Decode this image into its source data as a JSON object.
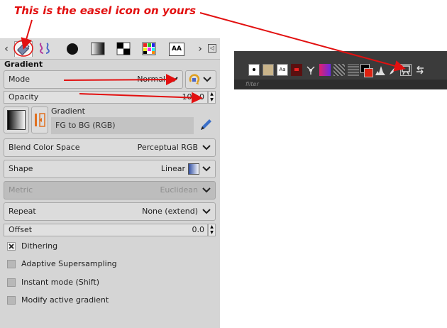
{
  "annotation": {
    "text": "This is the easel icon on yours",
    "color": "#e21010"
  },
  "tabs": [
    {
      "name": "gradient-tool-options-tab",
      "selected": true
    },
    {
      "name": "paths-tab"
    },
    {
      "name": "brushes-tab"
    },
    {
      "name": "gradients-tab"
    },
    {
      "name": "patterns-tab"
    },
    {
      "name": "palettes-tab"
    },
    {
      "name": "fonts-tab",
      "label": "AA"
    }
  ],
  "panel": {
    "title": "Gradient",
    "mode": {
      "label": "Mode",
      "value": "Normal"
    },
    "opacity": {
      "label": "Opacity",
      "value": "100.0"
    },
    "gradient": {
      "label": "Gradient",
      "value": "FG to BG (RGB)"
    },
    "blend_color_space": {
      "label": "Blend Color Space",
      "value": "Perceptual RGB"
    },
    "shape": {
      "label": "Shape",
      "value": "Linear"
    },
    "metric": {
      "label": "Metric",
      "value": "Euclidean"
    },
    "repeat": {
      "label": "Repeat",
      "value": "None (extend)"
    },
    "offset": {
      "label": "Offset",
      "value": "0.0"
    },
    "checks": [
      {
        "label": "Dithering",
        "checked": true
      },
      {
        "label": "Adaptive Supersampling",
        "checked": false
      },
      {
        "label": "Instant mode  (Shift)",
        "checked": false
      },
      {
        "label": "Modify active gradient",
        "checked": false
      }
    ]
  },
  "toolbar_strip": {
    "search_text": "filter"
  },
  "colors": {
    "panel_bg": "#d5d5d5",
    "accent": "#e21010",
    "strip_bg": "#3b3b3b"
  }
}
